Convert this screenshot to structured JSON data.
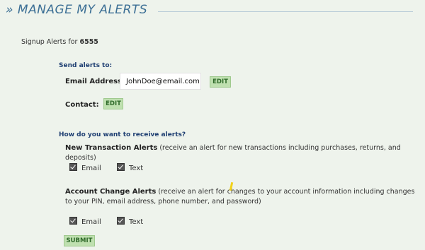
{
  "header": {
    "title": "» MANAGE MY ALERTS"
  },
  "signup": {
    "prefix": "Signup Alerts for ",
    "account": "6555"
  },
  "send_alerts": {
    "heading": "Send alerts to:",
    "email_label": "Email Address:",
    "email_value": "JohnDoe@email.com",
    "email_edit": "EDIT",
    "contact_label": "Contact:",
    "contact_edit": "EDIT"
  },
  "receive": {
    "heading": "How do you want to receive alerts?",
    "new_transaction": {
      "title": "New Transaction Alerts",
      "desc": " (receive an alert for new transactions including purchases, returns, and deposits)",
      "email": "Email",
      "text": "Text"
    },
    "account_change": {
      "title": "Account Change Alerts",
      "desc": " (receive an alert for changes to your account information including changes to your PIN, email address, phone number, and password)",
      "email": "Email",
      "text": "Text"
    }
  },
  "submit_label": "SUBMIT",
  "colors": {
    "accent_green": "#bfe0b0",
    "title_blue": "#3c6f95",
    "background": "#eef3ec"
  }
}
